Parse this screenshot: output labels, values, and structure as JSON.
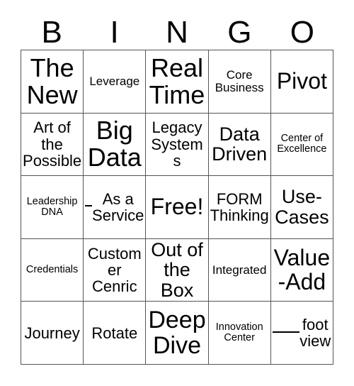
{
  "card": {
    "title": "BINGO",
    "background_color": "#ffffff",
    "border_color": "#555555",
    "text_color": "#000000",
    "columns": 5,
    "rows": 5
  },
  "header": {
    "letters": [
      "B",
      "I",
      "N",
      "G",
      "O"
    ]
  },
  "grid": {
    "cells": [
      {
        "text": "The New",
        "size": "fs-xxl",
        "blank": false
      },
      {
        "text": "Leverage",
        "size": "fs-sm",
        "blank": false
      },
      {
        "text": "Real Time",
        "size": "fs-xxl",
        "blank": false
      },
      {
        "text": "Core Business",
        "size": "fs-sm",
        "blank": false
      },
      {
        "text": "Pivot",
        "size": "fs-xl",
        "blank": false
      },
      {
        "text": "Art of the Possible",
        "size": "fs-md",
        "blank": false
      },
      {
        "text": "Big Data",
        "size": "fs-xxl",
        "blank": false
      },
      {
        "text": "Legacy Systems",
        "size": "fs-md",
        "blank": false
      },
      {
        "text": "Data Driven",
        "size": "fs-lg",
        "blank": false
      },
      {
        "text": "Center of Excellence",
        "size": "fs-xs",
        "blank": false
      },
      {
        "text": "Leadership DNA",
        "size": "fs-xs",
        "blank": false
      },
      {
        "text": "As a Service",
        "size": "fs-md",
        "blank": true,
        "blank_width": "blank-w-asaservice"
      },
      {
        "text": "Free!",
        "size": "fs-xl",
        "blank": false
      },
      {
        "text": "FORM Thinking",
        "size": "fs-md",
        "blank": false
      },
      {
        "text": "Use-Cases",
        "size": "fs-lg",
        "blank": false
      },
      {
        "text": "Credentials",
        "size": "fs-xs",
        "blank": false
      },
      {
        "text": "Customer Cenric",
        "size": "fs-md",
        "blank": false
      },
      {
        "text": "Out of the Box",
        "size": "fs-lg",
        "blank": false
      },
      {
        "text": "Integrated",
        "size": "fs-sm",
        "blank": false
      },
      {
        "text": "Value-Add",
        "size": "fs-xl",
        "blank": false
      },
      {
        "text": "Journey",
        "size": "fs-md",
        "blank": false
      },
      {
        "text": "Rotate",
        "size": "fs-md",
        "blank": false
      },
      {
        "text": "Deep Dive",
        "size": "fs-xxl",
        "blank": false
      },
      {
        "text": "Innovation Center",
        "size": "fs-xs",
        "blank": false
      },
      {
        "text": "foot view",
        "size": "fs-md",
        "blank": true,
        "blank_width": "blank-w-footview"
      }
    ]
  }
}
